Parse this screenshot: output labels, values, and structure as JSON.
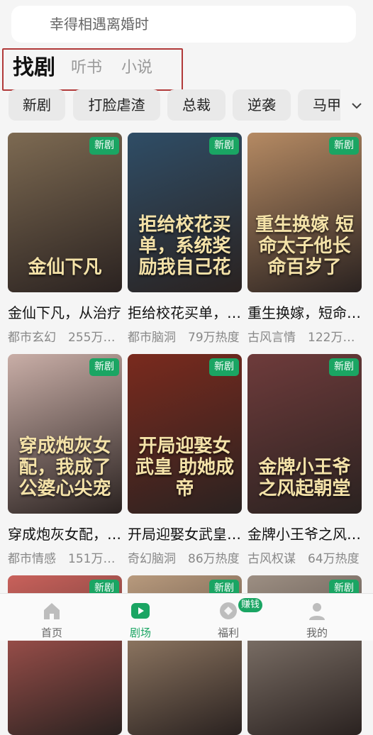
{
  "search": {
    "placeholder_text": "幸得相遇离婚时"
  },
  "tabs": [
    {
      "label": "找剧",
      "active": true
    },
    {
      "label": "听书",
      "active": false
    },
    {
      "label": "小说",
      "active": false
    }
  ],
  "chips": [
    "新剧",
    "打脸虐渣",
    "总裁",
    "逆袭",
    "马甲"
  ],
  "cards": [
    {
      "badge": "新剧",
      "poster_text": "金仙下凡",
      "title": "金仙下凡，从治疗…",
      "meta": "都市玄幻　255万…",
      "poster_color": "#7d6a52"
    },
    {
      "badge": "新剧",
      "poster_text": "拒给校花买单，系统奖励我自己花",
      "title": "拒给校花买单，…",
      "meta": "都市脑洞　79万热度",
      "poster_color": "#2f4d66"
    },
    {
      "badge": "新剧",
      "poster_text": "重生换嫁 短命太子他长命百岁了",
      "title": "重生换嫁，短命…",
      "meta": "古风言情　122万…",
      "poster_color": "#b58a63"
    },
    {
      "badge": "新剧",
      "poster_text": "穿成炮灰女配，我成了公婆心尖宠",
      "title": "穿成炮灰女配，…",
      "meta": "都市情感　151万…",
      "poster_color": "#c9aea7"
    },
    {
      "badge": "新剧",
      "poster_text": "开局迎娶女武皇 助她成帝",
      "title": "开局迎娶女武皇…",
      "meta": "奇幻脑洞　86万热度",
      "poster_color": "#7a2a1e"
    },
    {
      "badge": "新剧",
      "poster_text": "金牌小王爷之风起朝堂",
      "title": "金牌小王爷之风…",
      "meta": "古风权谋　64万热度",
      "poster_color": "#6e3b3b"
    },
    {
      "badge": "新剧",
      "poster_text": "",
      "title": "",
      "meta": "",
      "poster_color": "#c9615b"
    },
    {
      "badge": "新剧",
      "poster_text": "",
      "title": "",
      "meta": "",
      "poster_color": "#b89a7d"
    },
    {
      "badge": "新剧",
      "poster_text": "",
      "title": "",
      "meta": "",
      "poster_color": "#9d8f83"
    }
  ],
  "nav": [
    {
      "label": "首页",
      "icon": "home-icon",
      "active": false
    },
    {
      "label": "剧场",
      "icon": "play-icon",
      "active": true
    },
    {
      "label": "福利",
      "icon": "coin-icon",
      "active": false,
      "badge": "赚钱"
    },
    {
      "label": "我的",
      "icon": "user-icon",
      "active": false
    }
  ],
  "colors": {
    "accent": "#1aa563"
  }
}
